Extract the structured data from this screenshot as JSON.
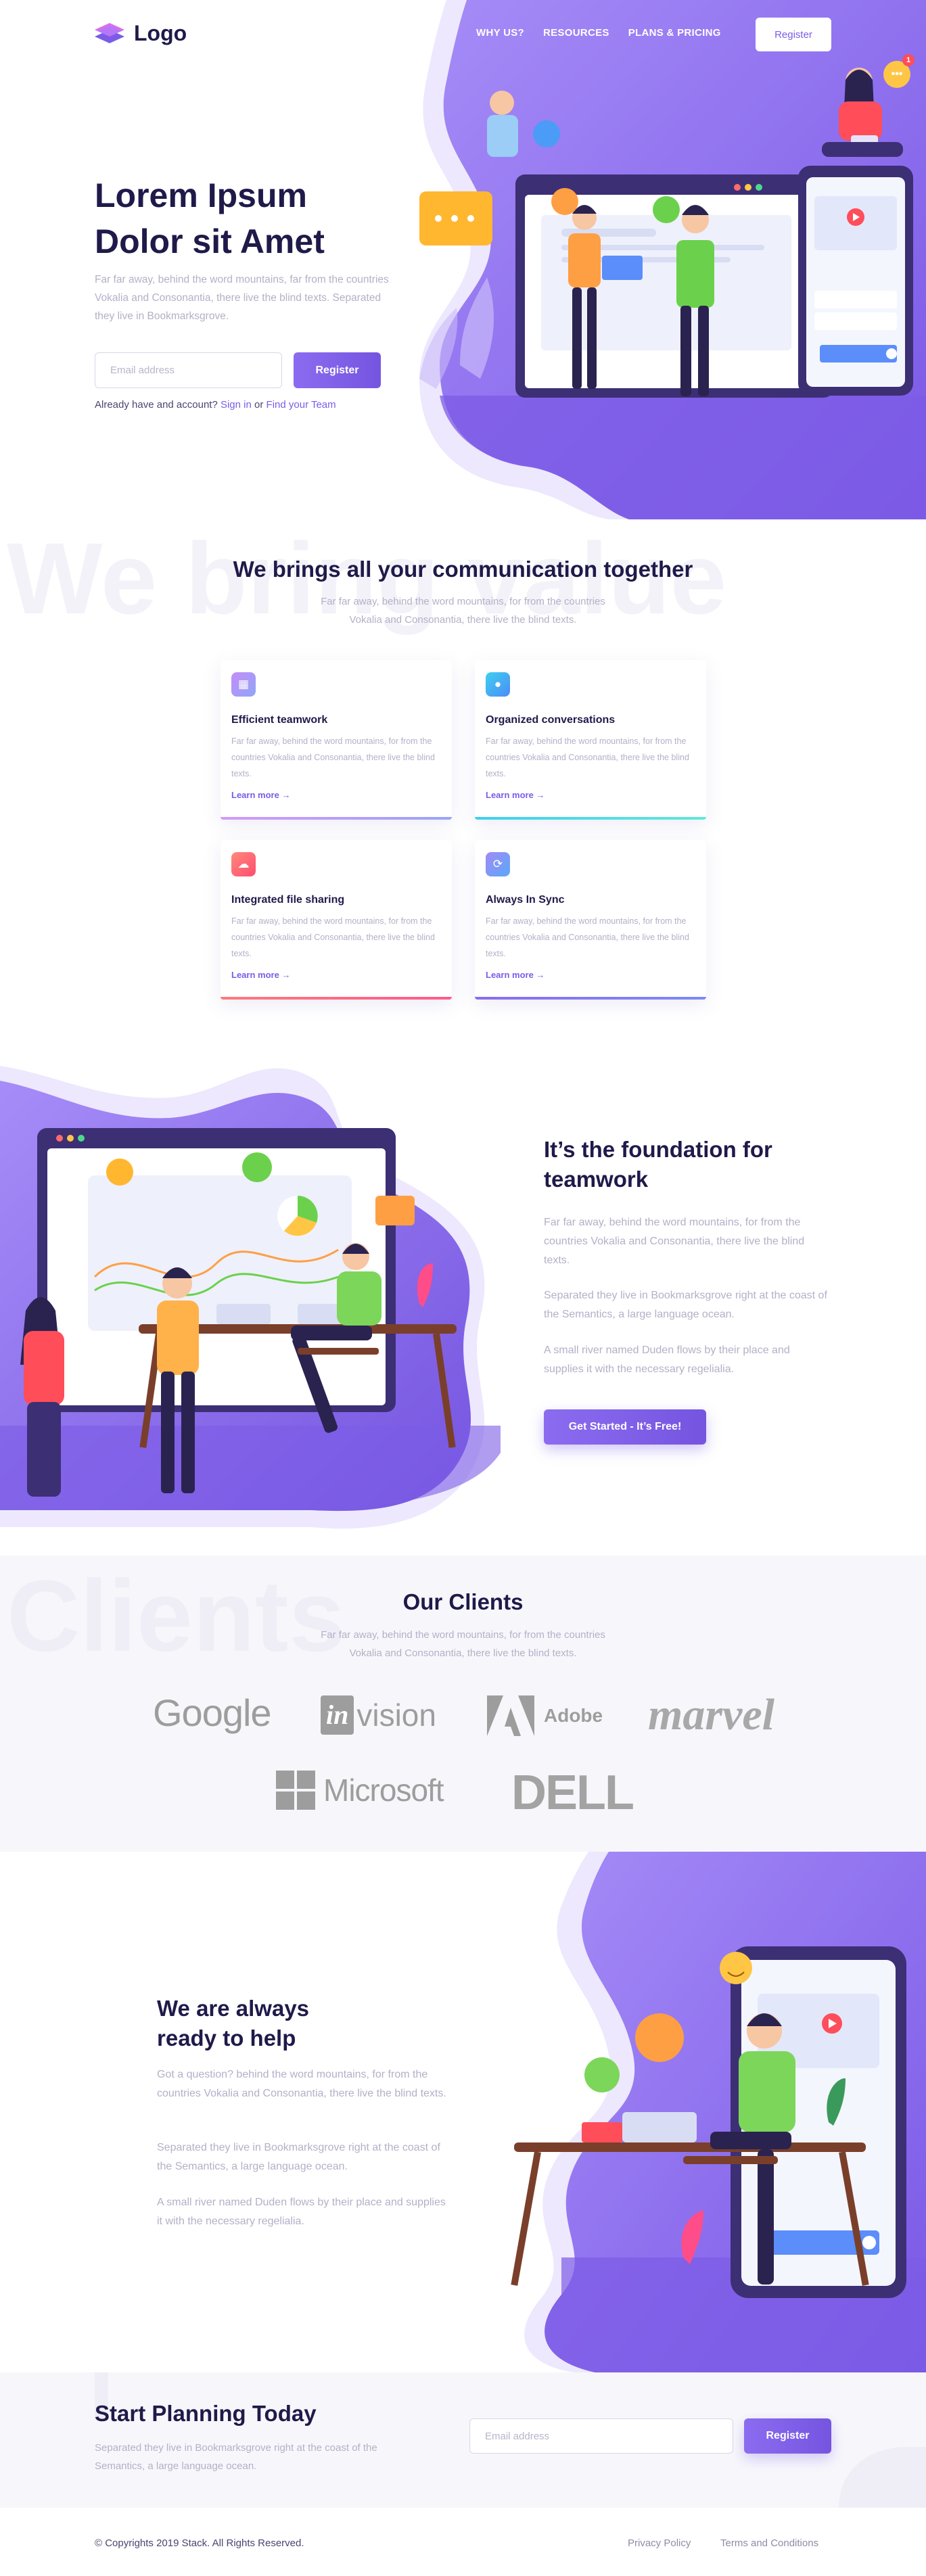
{
  "header": {
    "logo_text": "Logo",
    "nav": [
      "WHY US?",
      "RESOURCES",
      "PLANS & PRICING"
    ],
    "register_label": "Register"
  },
  "hero": {
    "title_line1": "Lorem Ipsum",
    "title_line2": "Dolor sit Amet",
    "description": "Far far away, behind the word mountains, far from the countries Vokalia and Consonantia, there live the blind texts. Separated they live in Bookmarksgrove.",
    "email_placeholder": "Email address",
    "register_label": "Register",
    "account_prefix": "Already have and account?",
    "sign_in": "Sign in",
    "or": "or",
    "find_team": "Find your Team",
    "notification_count": "1"
  },
  "features": {
    "watermark": "We bring value",
    "title": "We brings all your communication together",
    "subtitle_line1": "Far far away, behind the word mountains,  for from the countries",
    "subtitle_line2": "Vokalia and Consonantia, there live the blind texts.",
    "cards": [
      {
        "title": "Efficient teamwork",
        "text": "Far far away, behind the word mountains,  for from the countries Vokalia and Consonantia, there live the blind texts.",
        "link": "Learn more",
        "icon": "grid-icon",
        "color": "#b57cf5"
      },
      {
        "title": "Organized conversations",
        "text": "Far far away, behind the word mountains,  for from the countries Vokalia and Consonantia, there live the blind texts.",
        "link": "Learn more",
        "icon": "chat-icon",
        "color": "#3ed0f0"
      },
      {
        "title": "Integrated file sharing",
        "text": "Far far away, behind the word mountains,  for from the countries Vokalia and Consonantia, there live the blind texts.",
        "link": "Learn more",
        "icon": "cloud-icon",
        "color": "#ff6b6b"
      },
      {
        "title": "Always In Sync",
        "text": "Far far away, behind the word mountains,  for from the countries Vokalia and Consonantia, there live the blind texts.",
        "link": "Learn more",
        "icon": "sync-icon",
        "color": "#7b6cf0"
      }
    ]
  },
  "foundation": {
    "title_line1": "It’s the foundation for",
    "title_line2": "teamwork",
    "p1": "Far far away, behind the word mountains,  for from the countries Vokalia and Consonantia, there live the blind texts.",
    "p2": "Separated they live in Bookmarksgrove right at the coast of the Semantics, a large language ocean.",
    "p3": "A small river named Duden flows by their place and supplies it with the necessary regelialia.",
    "cta": "Get Started - It’s Free!"
  },
  "clients": {
    "watermark": "Clients",
    "title": "Our Clients",
    "subtitle_line1": "Far far away, behind the word mountains,  for from the countries",
    "subtitle_line2": "Vokalia and Consonantia, there live the blind texts.",
    "logos": {
      "google": "Google",
      "invision_in": "in",
      "invision_rest": "vision",
      "adobe": "Adobe",
      "marvel": "marvel",
      "microsoft": "Microsoft",
      "dell": "DELL"
    }
  },
  "help": {
    "title_line1": "We are always",
    "title_line2": "ready to help",
    "p1": "Got a question? behind the word mountains,  for from the countries Vokalia and Consonantia, there live the blind texts.",
    "p2": "Separated they live in Bookmarksgrove right at the coast of the Semantics, a large language ocean.",
    "p3": "A small river named Duden flows by their place and supplies it with the necessary regelialia."
  },
  "planning": {
    "title": "Start Planning Today",
    "text": "Separated they live in Bookmarksgrove right at the coast of the Semantics, a large language ocean.",
    "email_placeholder": "Email address",
    "register_label": "Register"
  },
  "footer": {
    "copyright": "© Copyrights 2019 Stack. All Rights Reserved.",
    "privacy": "Privacy Policy",
    "terms": "Terms and Conditions"
  },
  "colors": {
    "accent": "#7b5ce8",
    "dark": "#1f1a4a",
    "muted": "#b3b0c7",
    "hero_bg": "#8d6df1"
  }
}
